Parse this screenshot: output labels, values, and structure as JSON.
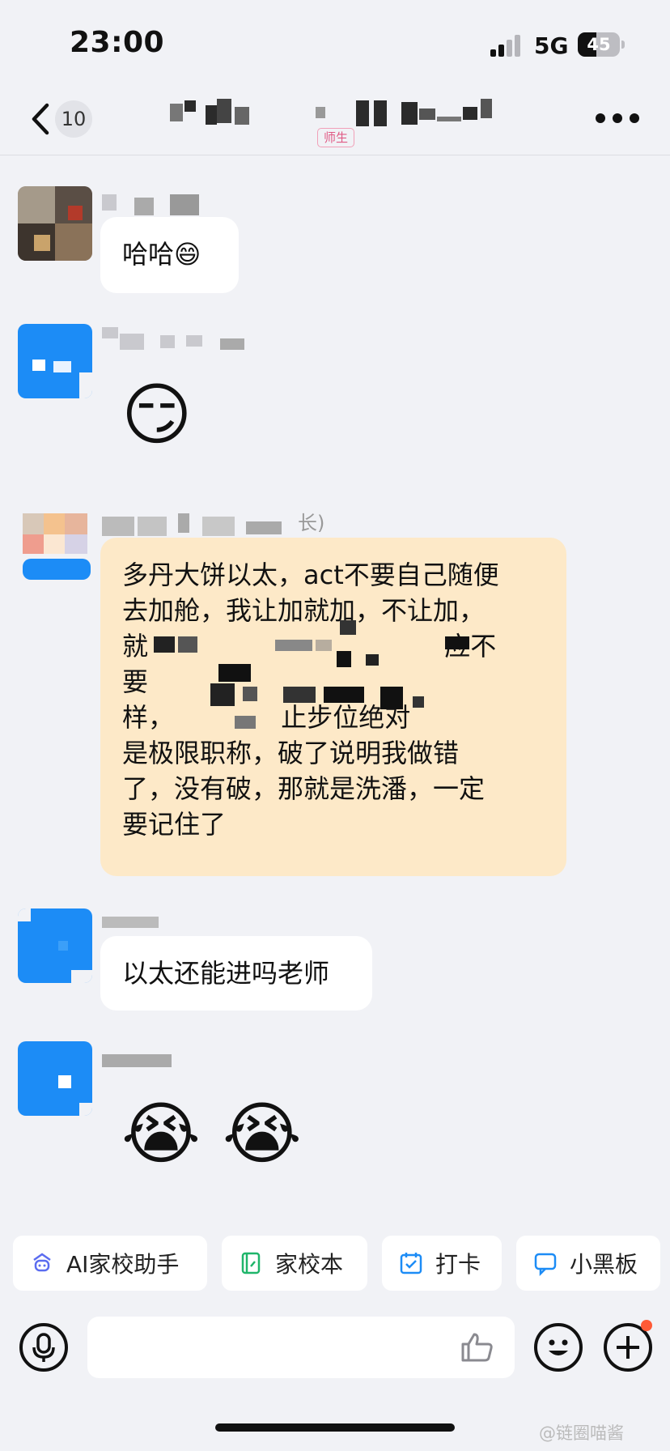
{
  "status_bar": {
    "time": "23:00",
    "network": "5G",
    "battery": "45",
    "battery_level": 0.45
  },
  "nav": {
    "unread_count": "10",
    "role_tag": "师生"
  },
  "messages": [
    {
      "text": "哈哈😄"
    },
    {
      "emoji": "😏"
    },
    {
      "name_suffix": "长)",
      "text": "多丹大饼以太，act不要自己随便\n去加舱，我让加就加，不让加，\n就                                    应不\n要             \n样，             止步位绝对\n是极限职称，破了说明我做错\n了，没有破，那就是洗潘，一定\n要记住了"
    },
    {
      "text": "以太还能进吗老师"
    },
    {
      "emoji": "😭 😭"
    }
  ],
  "toolbar": {
    "items": [
      {
        "label": "AI家校助手",
        "icon": "robot-icon"
      },
      {
        "label": "家校本",
        "icon": "notebook-icon"
      },
      {
        "label": "打卡",
        "icon": "calendar-check-icon"
      },
      {
        "label": "小黑板",
        "icon": "chat-board-icon"
      }
    ]
  },
  "input": {
    "placeholder": ""
  },
  "watermark": "@链圈喵酱",
  "colors": {
    "accent_blue": "#1c8cf6",
    "bubble_yellow": "#fde9c8",
    "background": "#f1f2f6"
  }
}
